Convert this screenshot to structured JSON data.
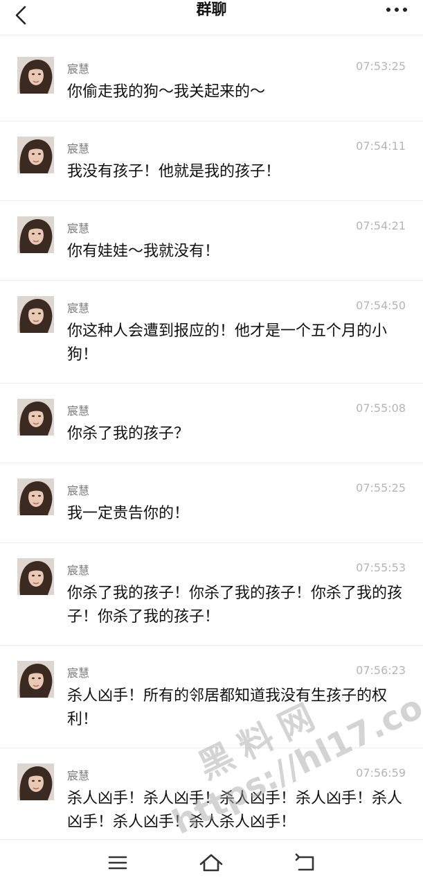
{
  "header": {
    "title": "群聊",
    "back_icon": "chevron-left-icon",
    "more_icon": "more-dots-icon"
  },
  "messages": [
    {
      "sender": "宸慧",
      "time": "07:53:25",
      "text": "你偷走我的狗～我关起来的～"
    },
    {
      "sender": "宸慧",
      "time": "07:54:11",
      "text": "我没有孩子！他就是我的孩子！"
    },
    {
      "sender": "宸慧",
      "time": "07:54:21",
      "text": "你有娃娃～我就没有！"
    },
    {
      "sender": "宸慧",
      "time": "07:54:50",
      "text": "你这种人会遭到报应的！他才是一个五个月的小狗！"
    },
    {
      "sender": "宸慧",
      "time": "07:55:08",
      "text": "你杀了我的孩子？"
    },
    {
      "sender": "宸慧",
      "time": "07:55:25",
      "text": "我一定贵告你的！"
    },
    {
      "sender": "宸慧",
      "time": "07:55:53",
      "text": "你杀了我的孩子！你杀了我的孩子！你杀了我的孩子！你杀了我的孩子！"
    },
    {
      "sender": "宸慧",
      "time": "07:56:23",
      "text": "杀人凶手！所有的邻居都知道我没有生孩子的权利！"
    },
    {
      "sender": "宸慧",
      "time": "07:56:59",
      "text": "杀人凶手！杀人凶手！杀人凶手！杀人凶手！杀人凶手！杀人凶手！杀人杀人凶手！"
    }
  ],
  "navbar": {
    "menu_icon": "menu-icon",
    "home_icon": "home-icon",
    "back_icon": "return-icon"
  },
  "watermark": {
    "line1": "黑料网",
    "line2": "https://hl17.co"
  },
  "colors": {
    "background": "#ffffff",
    "divider": "#ececec",
    "sender": "#7a7a7a",
    "time": "#b5b5b5",
    "text": "#111111"
  }
}
